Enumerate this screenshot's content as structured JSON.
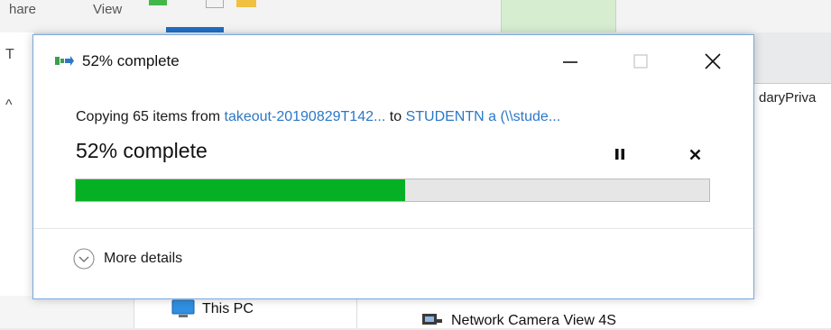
{
  "background": {
    "ribbon_tabs": [
      "hare",
      "View"
    ],
    "left_marks": [
      "T",
      "^"
    ],
    "address_text": "daryPriva",
    "nav_item": "This PC",
    "content_item": "Network Camera View 4S"
  },
  "dialog": {
    "title": "52% complete",
    "copy_prefix": "Copying 65 items from ",
    "source": "takeout-20190829T142...",
    "copy_to": " to ",
    "destination": "STUDENTN а (\\\\stude...",
    "percent_text": "52% complete",
    "progress_percent": 52,
    "more_details": "More details",
    "colors": {
      "progress_fill": "#06b025",
      "link": "#2b78c6",
      "border": "#7aa9de"
    },
    "icons": [
      "copy-transfer-icon",
      "minimize-icon",
      "maximize-icon",
      "close-icon",
      "pause-icon",
      "cancel-icon",
      "chevron-down-icon"
    ]
  }
}
